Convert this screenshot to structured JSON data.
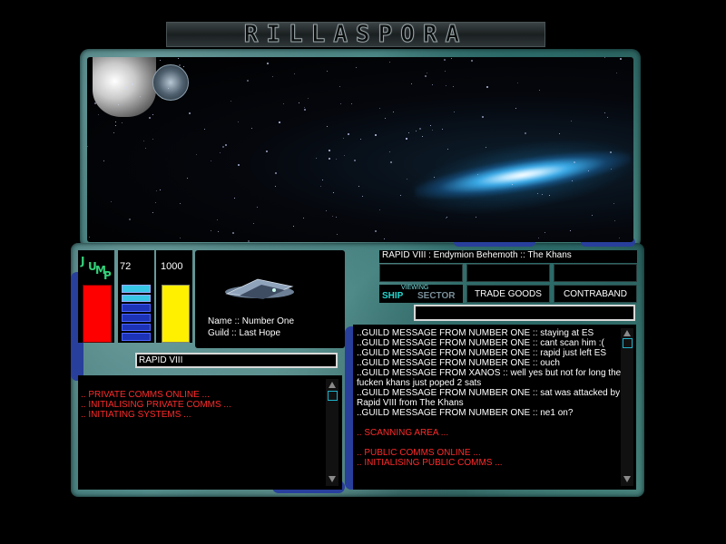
{
  "game": {
    "title": "RILLASPORA"
  },
  "status": {
    "jump_label_letters": [
      "J",
      "U",
      "M",
      "P"
    ],
    "fuel_value": "72",
    "credits_value": "1000"
  },
  "pilot": {
    "name_line": "Name :: Number One",
    "guild_line": "Guild :: Last Hope"
  },
  "target_input": {
    "value": "RAPID VIII"
  },
  "sector": {
    "label": "RAPID VIII : Endymion Behemoth :: The Khans"
  },
  "viewing": {
    "caption": "VIEWING",
    "ship_label": "SHIP",
    "sector_label": "SECTOR"
  },
  "buttons": {
    "trade_goods": "TRADE GOODS",
    "contraband": "CONTRABAND"
  },
  "private_comms": [
    ".. PRIVATE COMMS ONLINE ...",
    ".. INITIALISING PRIVATE COMMS ...",
    ".. INITIATING SYSTEMS ..."
  ],
  "public_comms": {
    "white": [
      "..GUILD MESSAGE FROM NUMBER ONE ::  staying at ES",
      "..GUILD MESSAGE FROM NUMBER ONE ::  cant scan him :(",
      "..GUILD MESSAGE FROM NUMBER ONE ::  rapid just left ES",
      "..GUILD MESSAGE FROM NUMBER ONE ::  ouch",
      "..GUILD MESSAGE FROM XANOS :: well yes but not for long the fucken khans just poped 2 sats",
      "..GUILD MESSAGE FROM NUMBER ONE ::  sat was attacked by Rapid VIII from The Khans",
      "..GUILD MESSAGE FROM NUMBER ONE ::  ne1 on?"
    ],
    "red_1": ".. SCANNING AREA ...",
    "red_2": ".. PUBLIC COMMS ONLINE ...",
    "red_3": ".. INITIALISING PUBLIC COMMS ..."
  },
  "colors": {
    "jump_bar": "#ff0000",
    "credits_bar": "#fff000",
    "fuel_gauge": "#1c33b8",
    "system_text": "#ff2a2a",
    "frame": "#4f8a88"
  },
  "icons": [
    "station-icon",
    "radar-disc-icon",
    "ship-icon",
    "scroll-up-icon",
    "scroll-down-icon"
  ]
}
